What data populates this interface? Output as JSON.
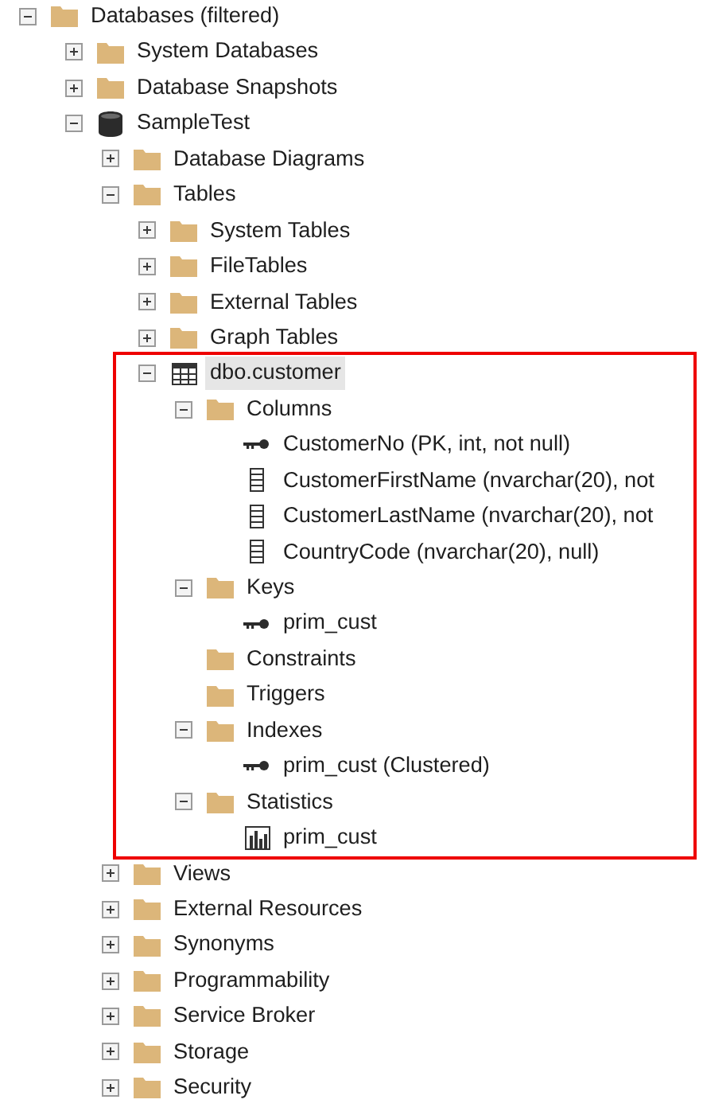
{
  "tree": [
    {
      "label": "Databases (filtered)",
      "kind": "folder",
      "expanded": true,
      "selected": false,
      "children": [
        {
          "label": "System Databases",
          "kind": "folder",
          "expanded": false,
          "selected": false
        },
        {
          "label": "Database Snapshots",
          "kind": "folder",
          "expanded": false,
          "selected": false
        },
        {
          "label": "SampleTest",
          "kind": "database",
          "expanded": true,
          "selected": false,
          "children": [
            {
              "label": "Database Diagrams",
              "kind": "folder",
              "expanded": false,
              "selected": false
            },
            {
              "label": "Tables",
              "kind": "folder",
              "expanded": true,
              "selected": false,
              "children": [
                {
                  "label": "System Tables",
                  "kind": "folder",
                  "expanded": false,
                  "selected": false
                },
                {
                  "label": "FileTables",
                  "kind": "folder",
                  "expanded": false,
                  "selected": false
                },
                {
                  "label": "External Tables",
                  "kind": "folder",
                  "expanded": false,
                  "selected": false
                },
                {
                  "label": "Graph Tables",
                  "kind": "folder",
                  "expanded": false,
                  "selected": false
                },
                {
                  "label": "dbo.customer",
                  "kind": "table",
                  "expanded": true,
                  "selected": true,
                  "highlighted": true,
                  "children": [
                    {
                      "label": "Columns",
                      "kind": "folder",
                      "expanded": true,
                      "selected": false,
                      "children": [
                        {
                          "label": "CustomerNo (PK, int, not null)",
                          "kind": "key",
                          "selected": false
                        },
                        {
                          "label": "CustomerFirstName (nvarchar(20), not",
                          "kind": "column",
                          "selected": false
                        },
                        {
                          "label": "CustomerLastName (nvarchar(20), not",
                          "kind": "column",
                          "selected": false
                        },
                        {
                          "label": "CountryCode (nvarchar(20), null)",
                          "kind": "column",
                          "selected": false
                        }
                      ]
                    },
                    {
                      "label": "Keys",
                      "kind": "folder",
                      "expanded": true,
                      "selected": false,
                      "children": [
                        {
                          "label": "prim_cust",
                          "kind": "key",
                          "selected": false
                        }
                      ]
                    },
                    {
                      "label": "Constraints",
                      "kind": "folder",
                      "selected": false
                    },
                    {
                      "label": "Triggers",
                      "kind": "folder",
                      "selected": false
                    },
                    {
                      "label": "Indexes",
                      "kind": "folder",
                      "expanded": true,
                      "selected": false,
                      "children": [
                        {
                          "label": "prim_cust (Clustered)",
                          "kind": "key",
                          "selected": false
                        }
                      ]
                    },
                    {
                      "label": "Statistics",
                      "kind": "folder",
                      "expanded": true,
                      "selected": false,
                      "children": [
                        {
                          "label": "prim_cust",
                          "kind": "statistics",
                          "selected": false
                        }
                      ]
                    }
                  ]
                }
              ]
            },
            {
              "label": "Views",
              "kind": "folder",
              "expanded": false,
              "selected": false
            },
            {
              "label": "External Resources",
              "kind": "folder",
              "expanded": false,
              "selected": false
            },
            {
              "label": "Synonyms",
              "kind": "folder",
              "expanded": false,
              "selected": false
            },
            {
              "label": "Programmability",
              "kind": "folder",
              "expanded": false,
              "selected": false
            },
            {
              "label": "Service Broker",
              "kind": "folder",
              "expanded": false,
              "selected": false
            },
            {
              "label": "Storage",
              "kind": "folder",
              "expanded": false,
              "selected": false
            },
            {
              "label": "Security",
              "kind": "folder",
              "expanded": false,
              "selected": false
            }
          ]
        }
      ]
    }
  ]
}
